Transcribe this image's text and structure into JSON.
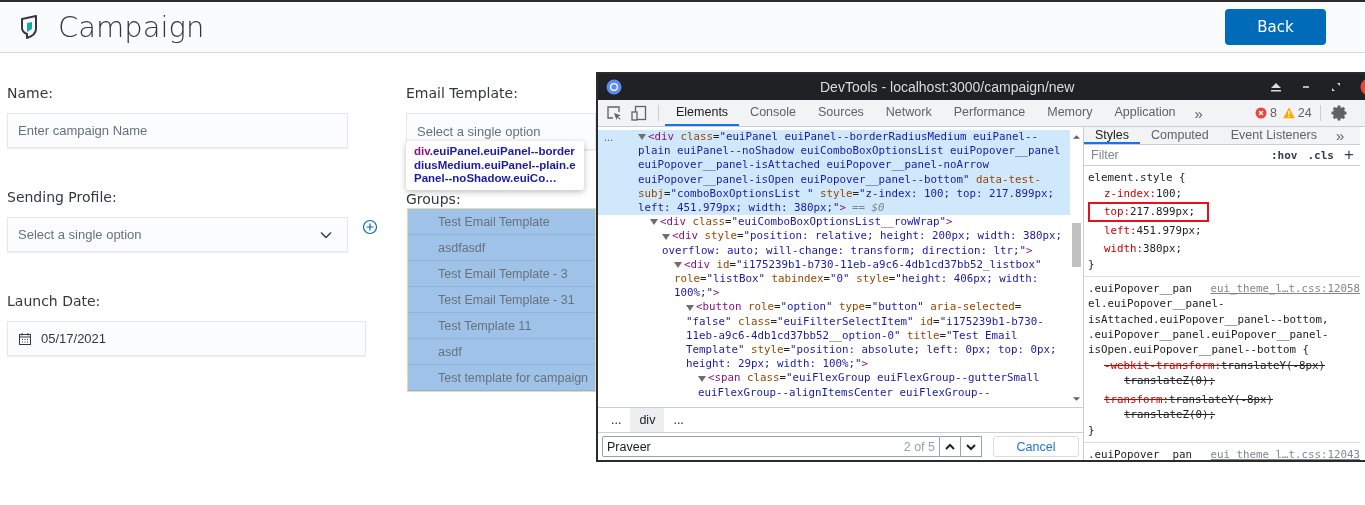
{
  "page": {
    "title": "Campaign",
    "back_button": "Back"
  },
  "form": {
    "name": {
      "label": "Name:",
      "placeholder": "Enter campaign Name"
    },
    "sending_profile": {
      "label": "Sending Profile:",
      "placeholder": "Select a single option"
    },
    "launch_date": {
      "label": "Launch Date:",
      "value": "05/17/2021"
    },
    "email_template": {
      "label": "Email Template:",
      "placeholder": "Select a single option"
    },
    "groups": {
      "label": "Groups:"
    }
  },
  "inspect_tooltip": {
    "tag": "div",
    "lines": [
      ".euiPanel.euiPanel--border",
      "diusMedium.euiPanel--plain.e",
      "Panel--noShadow.euiCo…"
    ]
  },
  "options_list": {
    "highlighted": true,
    "options": [
      {
        "label": "Test Email Template"
      },
      {
        "label": "asdfasdf"
      },
      {
        "label": "Test Email Template - 3"
      },
      {
        "label": "Test Email Template - 31"
      },
      {
        "label": "Test Template 11"
      },
      {
        "label": "asdf"
      },
      {
        "label": "Test template for campaign"
      }
    ]
  },
  "devtools": {
    "window_title": "DevTools - localhost:3000/campaign/new",
    "tabs": [
      {
        "label": "Elements",
        "selected": true
      },
      {
        "label": "Console",
        "selected": false
      },
      {
        "label": "Sources",
        "selected": false
      },
      {
        "label": "Network",
        "selected": false
      },
      {
        "label": "Performance",
        "selected": false
      },
      {
        "label": "Memory",
        "selected": false
      },
      {
        "label": "Application",
        "selected": false
      }
    ],
    "more_tabs": "»",
    "errors": "8",
    "warnings": "24",
    "dom_tree": [
      {
        "selected": true,
        "expanded": true,
        "dots": "...",
        "marker": "== $0",
        "lines": [
          "<div class=\"euiPanel euiPanel--borderRadiusMedium euiPanel--",
          "plain euiPanel--noShadow euiComboBoxOptionsList euiPopover__panel",
          "euiPopover__panel-isAttached euiPopover__panel-noArrow",
          "euiPopover__panel-isOpen euiPopover__panel--bottom\" data-test-",
          "subj=\"comboBoxOptionsList \" style=\"z-index: 100; top: 217.899px;",
          "left: 451.979px; width: 380px;\">"
        ],
        "children": [
          {
            "selected": false,
            "expanded": true,
            "lines": [
              "<div class=\"euiComboBoxOptionsList__rowWrap\">"
            ],
            "children": [
              {
                "selected": false,
                "expanded": true,
                "lines": [
                  "<div style=\"position: relative; height: 200px; width: 380px;",
                  "overflow: auto; will-change: transform; direction: ltr;\">"
                ],
                "children": [
                  {
                    "selected": false,
                    "expanded": true,
                    "lines": [
                      "<div id=\"i175239b1-b730-11eb-a9c6-4db1cd37bb52_listbox\"",
                      "role=\"listBox\" tabindex=\"0\" style=\"height: 406px; width:",
                      "100%;\">"
                    ],
                    "children": [
                      {
                        "selected": false,
                        "expanded": true,
                        "lines": [
                          "<button role=\"option\" type=\"button\" aria-selected=",
                          "\"false\" class=\"euiFilterSelectItem\" id=\"i175239b1-b730-",
                          "11eb-a9c6-4db1cd37bb52__option-0\" title=\"Test Email",
                          "Template\" style=\"position: absolute; left: 0px; top: 0px;",
                          "height: 29px; width: 100%;\">"
                        ],
                        "children": [
                          {
                            "selected": false,
                            "expanded": true,
                            "lines": [
                              "<span class=\"euiFlexGroup euiFlexGroup--gutterSmall",
                              "euiFlexGroup--alignItemsCenter euiFlexGroup--"
                            ]
                          }
                        ]
                      }
                    ]
                  }
                ]
              }
            ]
          }
        ]
      }
    ],
    "breadcrumbs": [
      {
        "label": "...",
        "selected": false
      },
      {
        "label": "div",
        "selected": true
      },
      {
        "label": "...",
        "selected": false
      }
    ],
    "search": {
      "value": "Praveer",
      "count": "2 of 5",
      "cancel": "Cancel"
    },
    "style_tabs": [
      {
        "label": "Styles",
        "selected": true
      },
      {
        "label": "Computed",
        "selected": false
      },
      {
        "label": "Event Listeners",
        "selected": false
      }
    ],
    "style_more": "»",
    "filter": {
      "placeholder": "Filter",
      "hov": ":hov",
      "cls": ".cls",
      "add": "+"
    },
    "rules": [
      {
        "selector_lines": [
          "element.style {"
        ],
        "declarations": [
          {
            "name": "z-index:",
            "value_lines": [
              "100;"
            ],
            "overridden": false,
            "highlighted": false
          },
          {
            "name": "top:",
            "value_lines": [
              "217.899px;"
            ],
            "overridden": false,
            "highlighted": true
          },
          {
            "name": "left:",
            "value_lines": [
              "451.979px;"
            ],
            "overridden": false,
            "highlighted": false
          },
          {
            "name": "width:",
            "value_lines": [
              "380px;"
            ],
            "overridden": false,
            "highlighted": false
          }
        ],
        "close": "}"
      },
      {
        "selector_lines": [
          ".euiPopover__pan",
          "el.euiPopover__panel-",
          "isAttached.euiPopover__panel--bottom,",
          ".euiPopover__panel.euiPopover__panel-",
          "isOpen.euiPopover__panel--bottom {"
        ],
        "source": "eui_theme_l…t.css:12058",
        "declarations": [
          {
            "name": "-webkit-transform:",
            "value_lines": [
              "translateY(-8px)",
              "translateZ(0);"
            ],
            "overridden": true,
            "highlighted": false
          },
          {
            "name": "transform:",
            "value_lines": [
              "translateY(-8px)",
              "translateZ(0);"
            ],
            "overridden": true,
            "highlighted": false
          }
        ],
        "close": "}"
      },
      {
        "selector_lines": [
          ".euiPopover__pan"
        ],
        "source": "eui_theme_l…t.css:12043"
      }
    ]
  }
}
